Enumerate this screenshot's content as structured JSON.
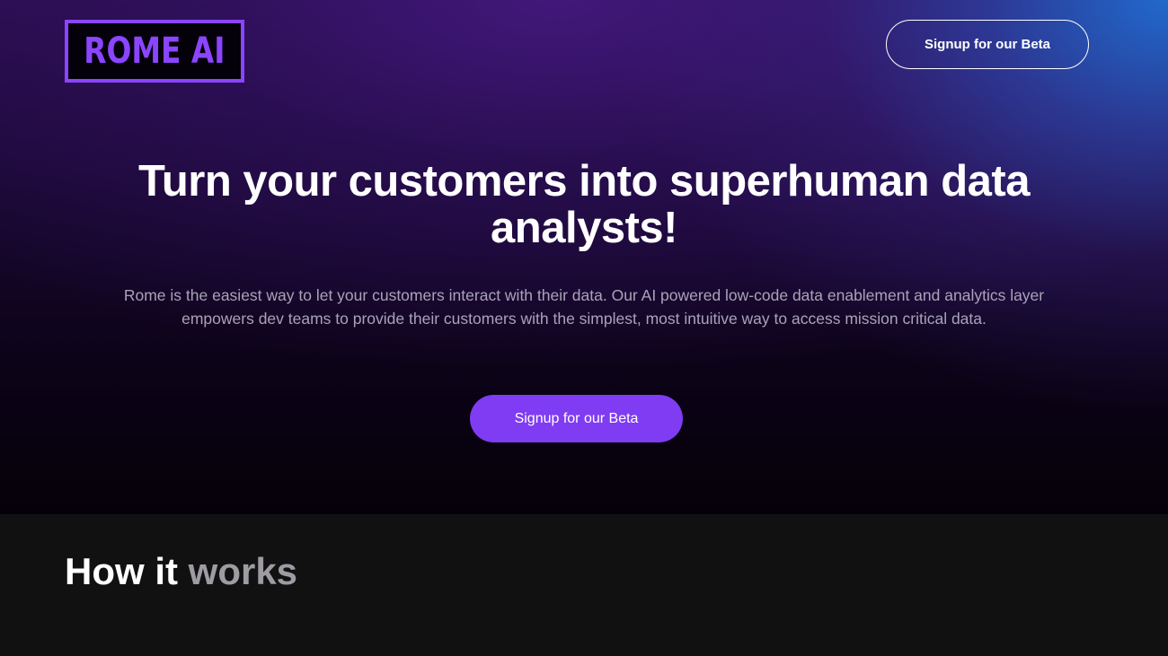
{
  "header": {
    "logo_text": "ROME AI",
    "signup_label": "Signup for our Beta"
  },
  "hero": {
    "title": "Turn your customers into superhuman data analysts!",
    "description": "Rome is the easiest way to let your customers interact with their data. Our AI powered low-code data enablement and analytics layer empowers dev teams to provide their customers with the simplest, most intuitive way to access mission critical data.",
    "cta_label": "Signup for our Beta"
  },
  "how_it_works": {
    "title_part1": "How it ",
    "title_part2": "works"
  },
  "colors": {
    "accent": "#7f3cf2",
    "logo": "#8b45ff",
    "section_bg": "#111111"
  }
}
